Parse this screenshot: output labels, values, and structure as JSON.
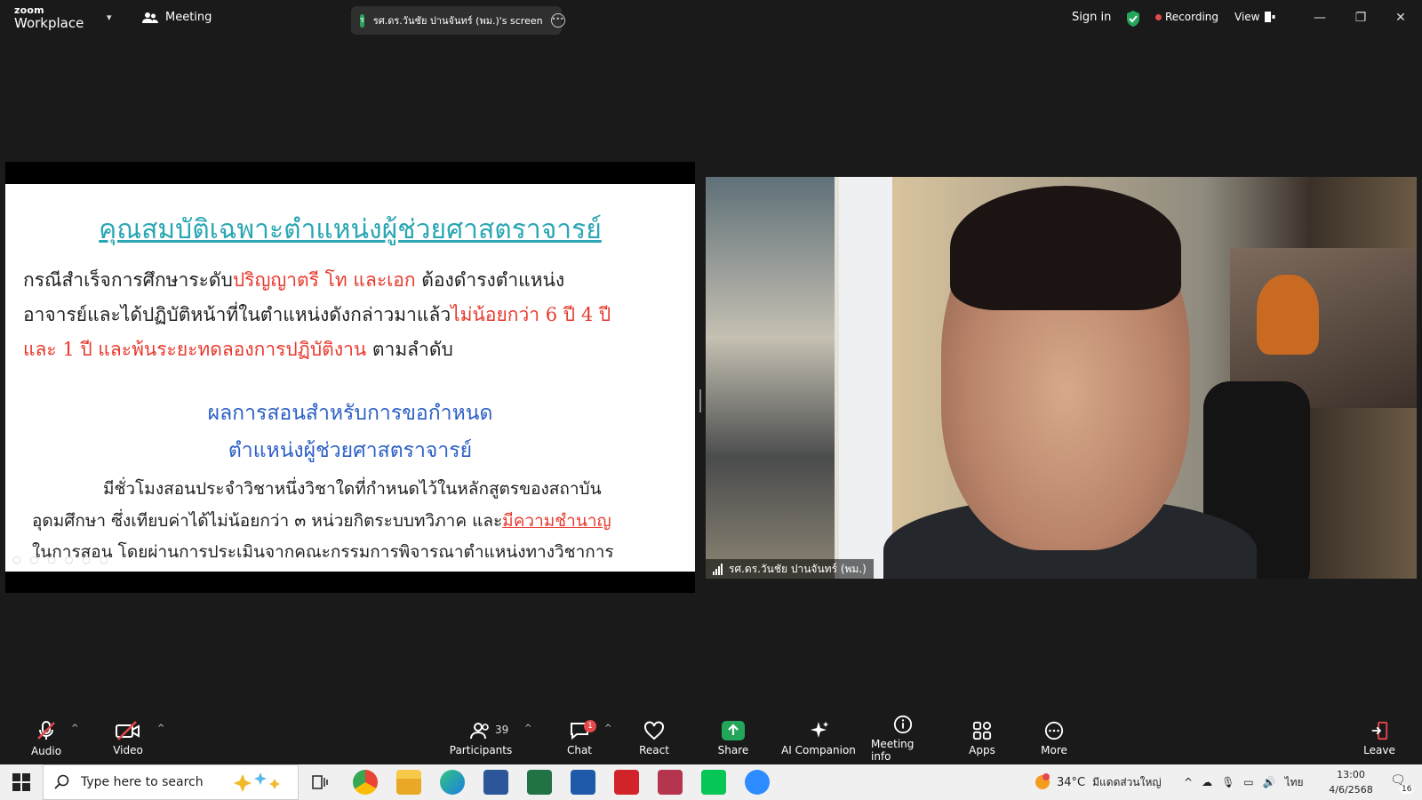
{
  "app": {
    "brand_top": "zoom",
    "brand_bottom": "Workplace"
  },
  "header": {
    "meeting_label": "Meeting",
    "screen_share_label": "รศ.ดร.วันชัย ปานจันทร์ (พม.)'s screen",
    "screen_share_badge": "ร",
    "sign_in": "Sign in",
    "recording": "Recording",
    "view": "View"
  },
  "slide": {
    "title": "คุณสมบัติเฉพาะตำแหน่งผู้ช่วยศาสตราจารย์",
    "para1_a": "กรณีสำเร็จการศึกษาระดับ",
    "para1_b": "ปริญญาตรี โท และเอก",
    "para1_c": " ต้องดำรงตำแหน่ง",
    "para2_a": "อาจารย์และได้ปฏิบัติหน้าที่ในตำแหน่งดังกล่าวมาแล้ว",
    "para2_b": "ไม่น้อยกว่า 6 ปี 4 ปี",
    "para3_a": "และ 1 ปี และพ้นระยะทดลองการปฏิบัติงาน",
    "para3_b": " ตามลำดับ",
    "subtitle1": "ผลการสอนสำหรับการขอกำหนด",
    "subtitle2": "ตำแหน่งผู้ช่วยศาสตราจารย์",
    "body1": "มีชั่วโมงสอนประจำวิชาหนึ่งวิชาใดที่กำหนดไว้ในหลักสูตรของสถาบัน",
    "body2_a": "อุดมศึกษา ซึ่งเทียบค่าได้ไม่น้อยกว่า ๓ หน่วยกิตระบบทวิภาค และ",
    "body2_b": "มีความชำนาญ",
    "body3": "ในการสอน โดยผ่านการประเมินจากคณะกรรมการพิจารณาตำแหน่งทางวิชาการ"
  },
  "video": {
    "participant_name": "รศ.ดร.วันชัย ปานจันทร์ (พม.)"
  },
  "toolbar": {
    "audio": "Audio",
    "video": "Video",
    "participants": "Participants",
    "participants_count": "39",
    "chat": "Chat",
    "chat_badge": "1",
    "react": "React",
    "share": "Share",
    "ai_companion": "AI Companion",
    "meeting_info": "Meeting info",
    "apps": "Apps",
    "more": "More",
    "leave": "Leave"
  },
  "taskbar": {
    "search_placeholder": "Type here to search",
    "weather_temp": "34°C",
    "weather_desc": "มีแดดส่วนใหญ่",
    "language": "ไทย",
    "time": "13:00",
    "date": "4/6/2568",
    "notification_count": "16"
  },
  "colors": {
    "accent_green": "#23a55a",
    "recording_red": "#e5484d",
    "slide_title": "#2aa6b4",
    "slide_red": "#e8392d",
    "slide_blue": "#2b5fc7"
  },
  "icons": [
    "meeting-icon",
    "shield-check-icon",
    "view-icon",
    "minimize-icon",
    "restore-icon",
    "close-icon",
    "mic-muted-icon",
    "video-off-icon",
    "participants-icon",
    "chat-icon",
    "heart-icon",
    "share-arrow-icon",
    "sparkle-icon",
    "info-icon",
    "apps-icon",
    "more-icon",
    "leave-icon",
    "windows-start-icon",
    "search-icon"
  ]
}
